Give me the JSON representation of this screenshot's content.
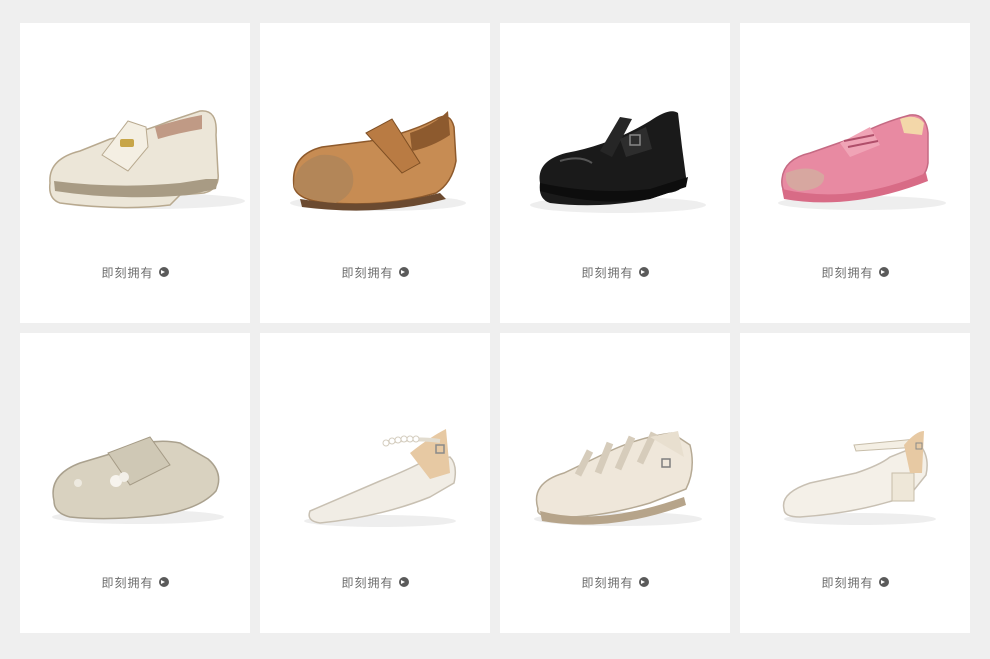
{
  "products": [
    {
      "name": "cream-loafer",
      "cta": "即刻拥有"
    },
    {
      "name": "tan-mary-jane",
      "cta": "即刻拥有"
    },
    {
      "name": "black-patent-mary-jane",
      "cta": "即刻拥有"
    },
    {
      "name": "pink-sneaker",
      "cta": "即刻拥有"
    },
    {
      "name": "beige-mule",
      "cta": "即刻拥有"
    },
    {
      "name": "pearl-strap-flat",
      "cta": "即刻拥有"
    },
    {
      "name": "fisherman-sandal",
      "cta": "即刻拥有"
    },
    {
      "name": "block-heel-mary-jane",
      "cta": "即刻拥有"
    }
  ],
  "icons": {
    "cta_icon": "chevron-right-circle-icon"
  },
  "colors": {
    "background": "#efefef",
    "card": "#ffffff",
    "cta_text": "#6e6e6e"
  }
}
